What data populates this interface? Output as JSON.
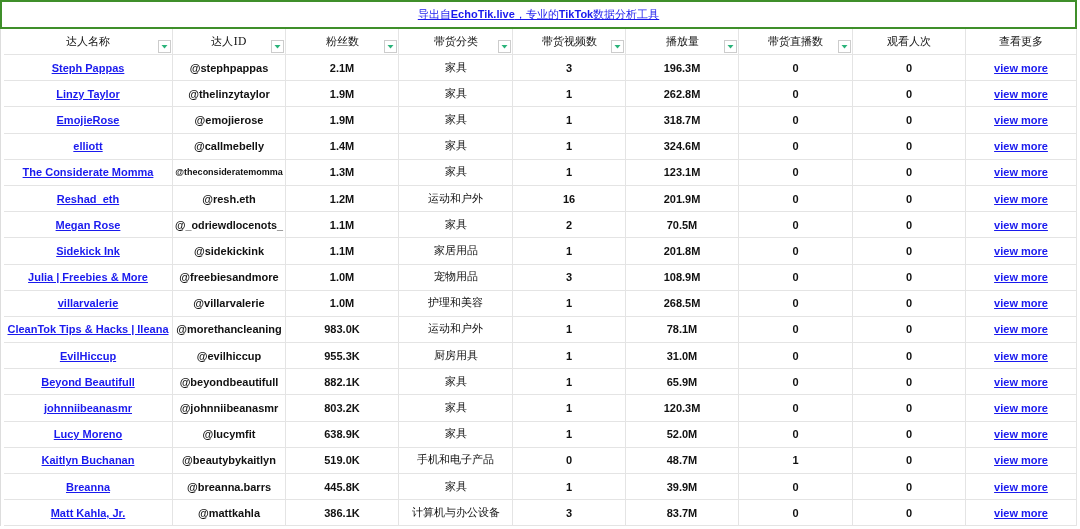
{
  "banner": {
    "text": "导出自**EchoTik.live**，专业的**TikTok**数据分析工具"
  },
  "columns": [
    {
      "label": "达人名称",
      "filter": true
    },
    {
      "label": "达人ID",
      "filter": true
    },
    {
      "label": "粉丝数",
      "filter": true
    },
    {
      "label": "带货分类",
      "filter": true
    },
    {
      "label": "带货视频数",
      "filter": true
    },
    {
      "label": "播放量",
      "filter": true
    },
    {
      "label": "带货直播数",
      "filter": true
    },
    {
      "label": "观看人次",
      "filter": false
    },
    {
      "label": "查看更多",
      "filter": false
    }
  ],
  "rows": [
    [
      "Steph Pappas",
      "@stephpappas",
      "2.1M",
      "家具",
      "3",
      "196.3M",
      "0",
      "0",
      "view more"
    ],
    [
      "Linzy Taylor",
      "@thelinzytaylor",
      "1.9M",
      "家具",
      "1",
      "262.8M",
      "0",
      "0",
      "view more"
    ],
    [
      "EmojieRose",
      "@emojierose",
      "1.9M",
      "家具",
      "1",
      "318.7M",
      "0",
      "0",
      "view more"
    ],
    [
      "elliott",
      "@callmebelly",
      "1.4M",
      "家具",
      "1",
      "324.6M",
      "0",
      "0",
      "view more"
    ],
    [
      "The Considerate Momma",
      "@theconsideratemomma",
      "1.3M",
      "家具",
      "1",
      "123.1M",
      "0",
      "0",
      "view more"
    ],
    [
      "Reshad_eth",
      "@resh.eth",
      "1.2M",
      "运动和户外",
      "16",
      "201.9M",
      "0",
      "0",
      "view more"
    ],
    [
      "Megan Rose",
      "@_odriewdlocenots_",
      "1.1M",
      "家具",
      "2",
      "70.5M",
      "0",
      "0",
      "view more"
    ],
    [
      "Sidekick Ink",
      "@sidekickink",
      "1.1M",
      "家居用品",
      "1",
      "201.8M",
      "0",
      "0",
      "view more"
    ],
    [
      "Julia | Freebies & More",
      "@freebiesandmore",
      "1.0M",
      "宠物用品",
      "3",
      "108.9M",
      "0",
      "0",
      "view more"
    ],
    [
      "villarvalerie",
      "@villarvalerie",
      "1.0M",
      "护理和美容",
      "1",
      "268.5M",
      "0",
      "0",
      "view more"
    ],
    [
      "CleanTok Tips & Hacks | Ileana",
      "@morethancleaning",
      "983.0K",
      "运动和户外",
      "1",
      "78.1M",
      "0",
      "0",
      "view more"
    ],
    [
      "EvilHiccup",
      "@evilhiccup",
      "955.3K",
      "厨房用具",
      "1",
      "31.0M",
      "0",
      "0",
      "view more"
    ],
    [
      "Beyond Beautifull",
      "@beyondbeautifull",
      "882.1K",
      "家具",
      "1",
      "65.9M",
      "0",
      "0",
      "view more"
    ],
    [
      "johnniibeanasmr",
      "@johnniibeanasmr",
      "803.2K",
      "家具",
      "1",
      "120.3M",
      "0",
      "0",
      "view more"
    ],
    [
      "Lucy Moreno",
      "@lucymfit",
      "638.9K",
      "家具",
      "1",
      "52.0M",
      "0",
      "0",
      "view more"
    ],
    [
      "Kaitlyn Buchanan",
      "@beautybykaitlyn",
      "519.0K",
      "手机和电子产品",
      "0",
      "48.7M",
      "1",
      "0",
      "view more"
    ],
    [
      "Breanna",
      "@breanna.barrs",
      "445.8K",
      "家具",
      "1",
      "39.9M",
      "0",
      "0",
      "view more"
    ],
    [
      "Matt Kahla, Jr.",
      "@mattkahla",
      "386.1K",
      "计算机与办公设备",
      "3",
      "83.7M",
      "0",
      "0",
      "view more"
    ]
  ]
}
